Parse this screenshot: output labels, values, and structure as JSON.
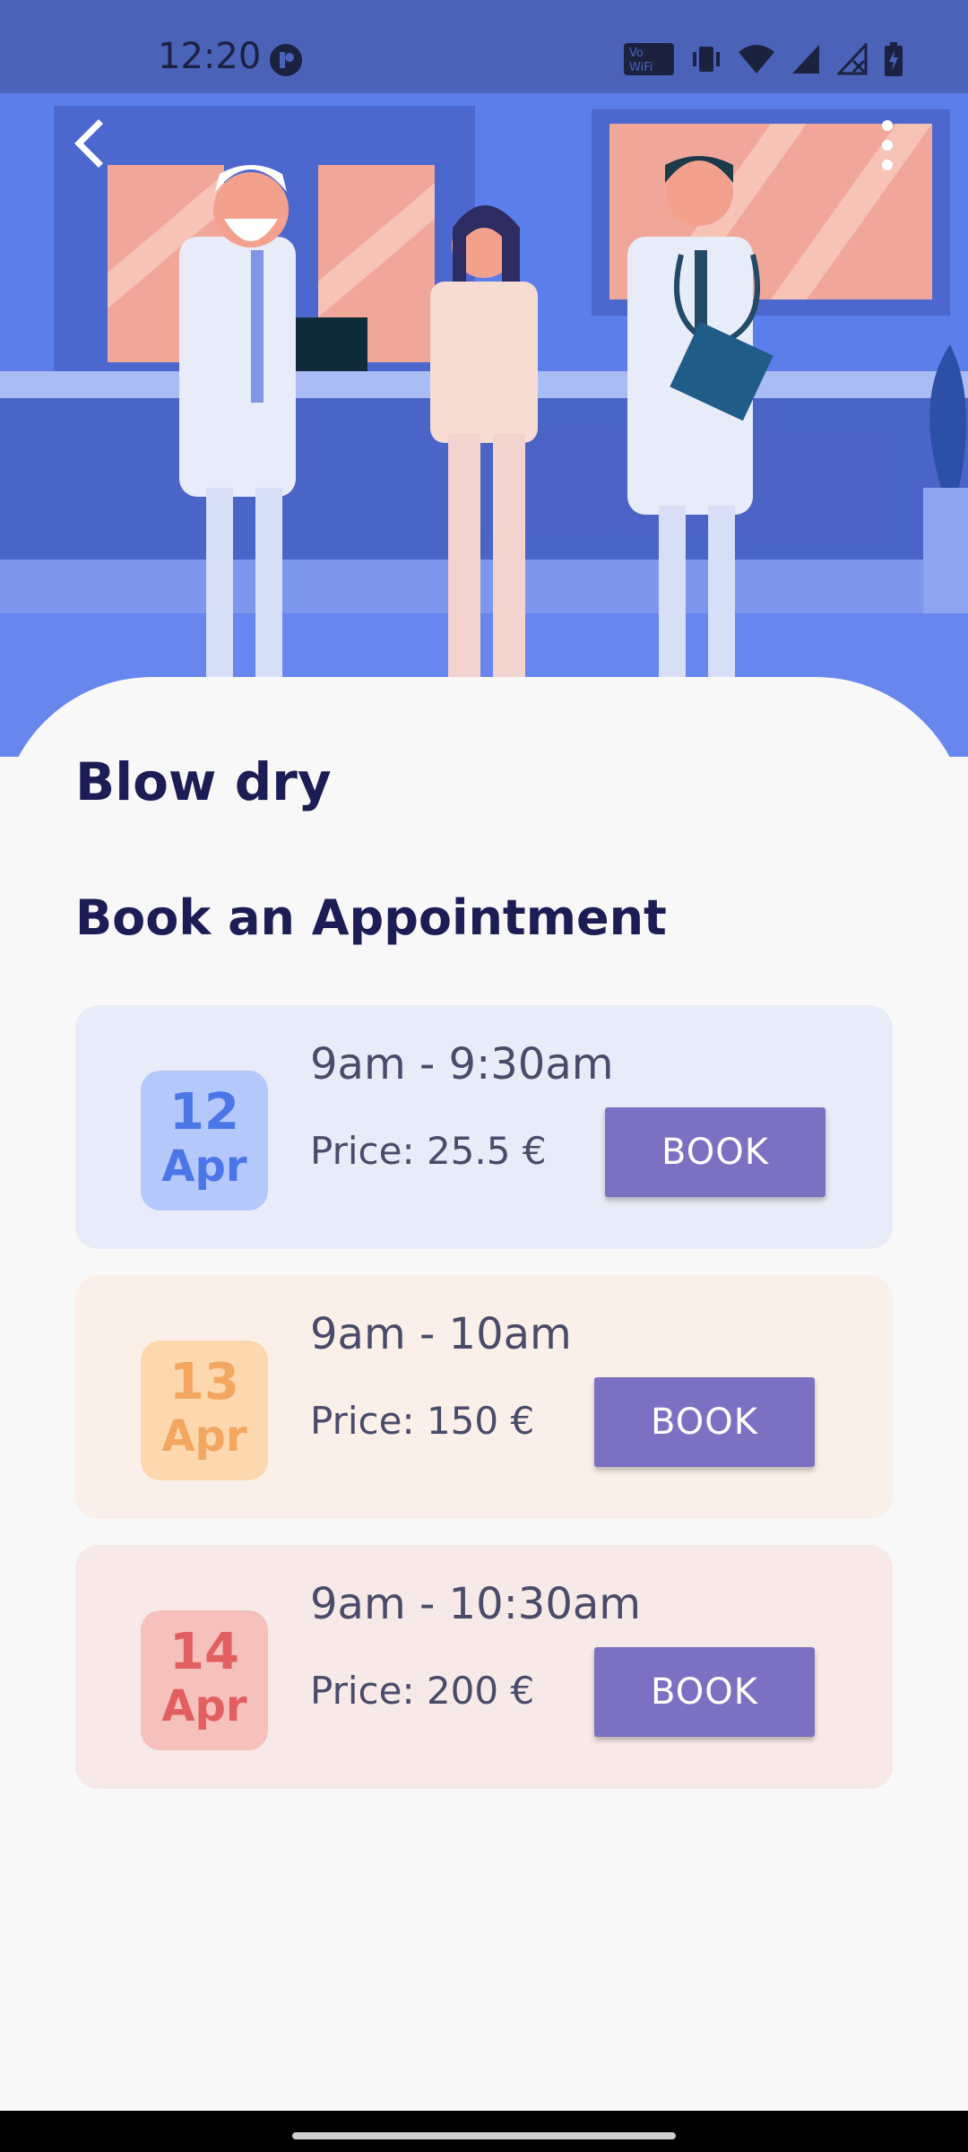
{
  "status_bar": {
    "time": "12:20",
    "icons": [
      "vowifi-icon",
      "vibrate-icon",
      "wifi-icon",
      "signal-icon",
      "signal-no-data-icon",
      "battery-charging-icon"
    ]
  },
  "header": {
    "back_icon": "back-chevron-icon",
    "menu_icon": "more-vertical-icon"
  },
  "service": {
    "title": "Blow dry",
    "section_title": "Book an Appointment"
  },
  "slots": [
    {
      "day": "12",
      "month": "Apr",
      "time": "9am - 9:30am",
      "price": "Price: 25.5 €",
      "button": "BOOK",
      "bg": "#e8ecf8",
      "badge_bg": "#b5c8fb",
      "badge_fg": "#4a76e8"
    },
    {
      "day": "13",
      "month": "Apr",
      "time": "9am - 10am",
      "price": "Price: 150 €",
      "button": "BOOK",
      "bg": "#fbf0e9",
      "badge_bg": "#fdd7ad",
      "badge_fg": "#f3a660"
    },
    {
      "day": "14",
      "month": "Apr",
      "time": "9am - 10:30am",
      "price": "Price: 200 €",
      "button": "BOOK",
      "bg": "#f7e9e7",
      "badge_bg": "#f6c0bd",
      "badge_fg": "#e25f5f"
    }
  ],
  "colors": {
    "status_bar": "#4a63b9",
    "hero_bg": "#5b7eea",
    "title_text": "#1d1d55",
    "button_bg": "#7b70c1"
  }
}
